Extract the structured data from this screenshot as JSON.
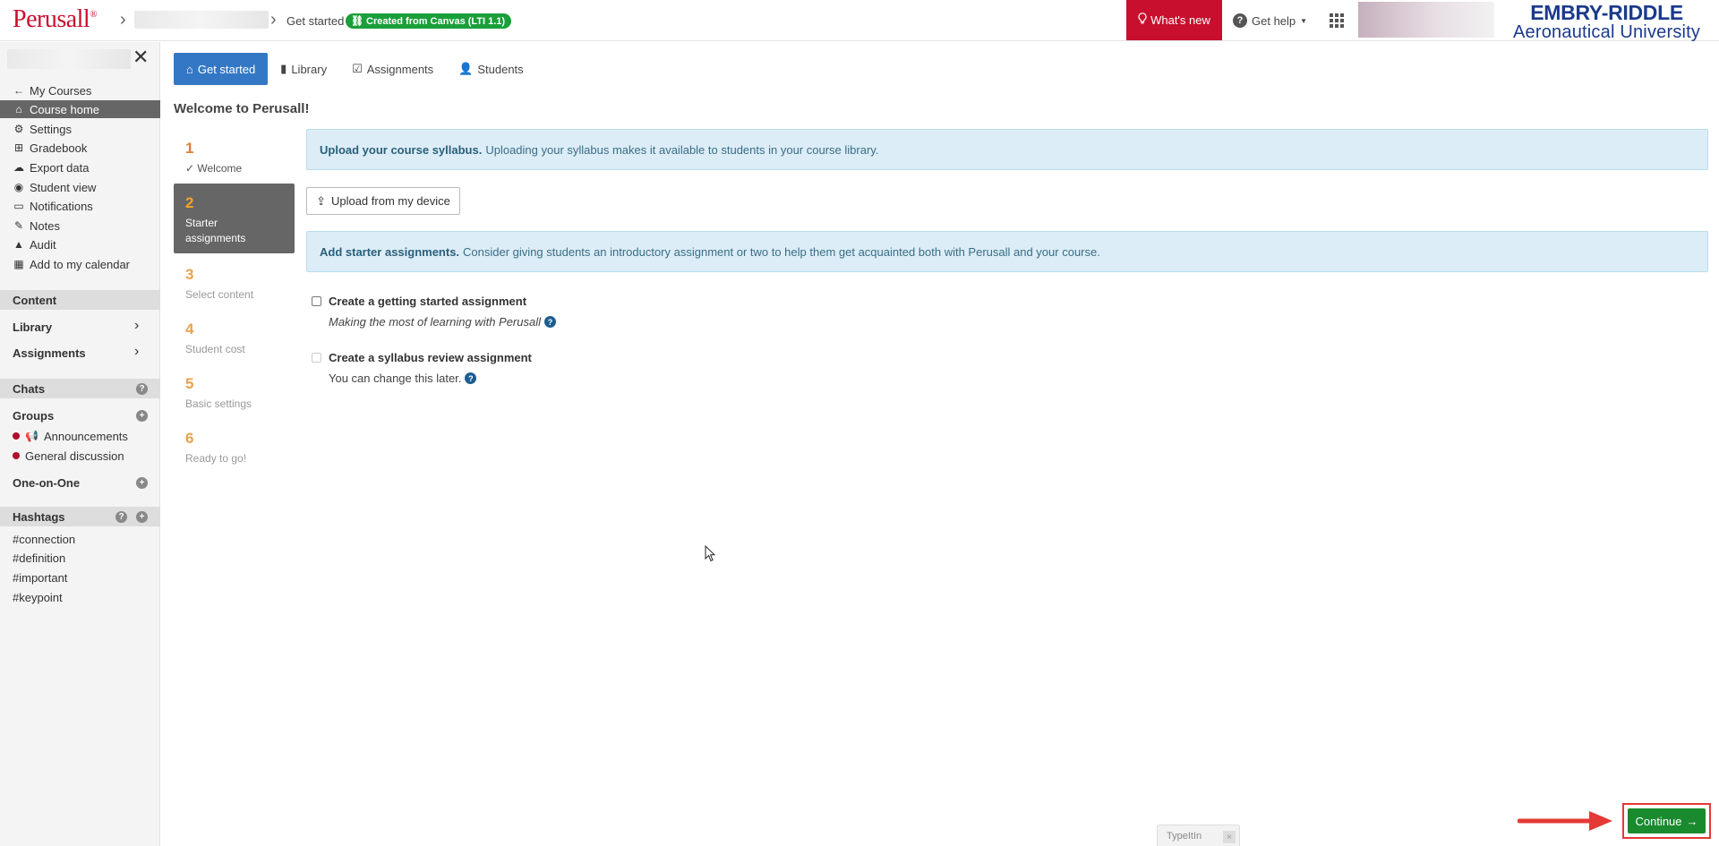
{
  "topbar": {
    "logo": "Perusall",
    "logo_mark": "®",
    "crumb_current": "Get started",
    "lti_badge": "Created from Canvas (LTI 1.1)",
    "whats_new": "What's new",
    "get_help": "Get help",
    "erau_line1": "EMBRY-RIDDLE",
    "erau_line2": "Aeronautical University"
  },
  "sidebar": {
    "nav": [
      {
        "label": "My Courses",
        "icon": "arrow-left-icon"
      },
      {
        "label": "Course home",
        "icon": "home-icon"
      },
      {
        "label": "Settings",
        "icon": "gear-icon"
      },
      {
        "label": "Gradebook",
        "icon": "table-icon"
      },
      {
        "label": "Export data",
        "icon": "cloud-download-icon"
      },
      {
        "label": "Student view",
        "icon": "eye-icon"
      },
      {
        "label": "Notifications",
        "icon": "inbox-icon"
      },
      {
        "label": "Notes",
        "icon": "pencil-icon"
      },
      {
        "label": "Audit",
        "icon": "warning-icon"
      },
      {
        "label": "Add to my calendar",
        "icon": "calendar-icon"
      }
    ],
    "content_section": "Content",
    "library": "Library",
    "assignments": "Assignments",
    "chats_section": "Chats",
    "groups": "Groups",
    "group_items": [
      "Announcements",
      "General discussion"
    ],
    "one_on_one": "One-on-One",
    "hashtags_section": "Hashtags",
    "hashtags": [
      "#connection",
      "#definition",
      "#important",
      "#keypoint"
    ]
  },
  "tabs": [
    {
      "label": "Get started",
      "icon": "home-icon"
    },
    {
      "label": "Library",
      "icon": "book-icon"
    },
    {
      "label": "Assignments",
      "icon": "calendar-check-icon"
    },
    {
      "label": "Students",
      "icon": "user-icon"
    }
  ],
  "page_title": "Welcome to Perusall!",
  "steps": [
    {
      "num": "1",
      "label": "Welcome"
    },
    {
      "num": "2",
      "label_line1": "Starter",
      "label_line2": "assignments"
    },
    {
      "num": "3",
      "label": "Select content"
    },
    {
      "num": "4",
      "label": "Student cost"
    },
    {
      "num": "5",
      "label": "Basic settings"
    },
    {
      "num": "6",
      "label": "Ready to go!"
    }
  ],
  "syllabus_info": {
    "bold": "Upload your course syllabus.",
    "text": "Uploading your syllabus makes it available to students in your course library."
  },
  "upload_button": "Upload from my device",
  "starter_info": {
    "bold": "Add starter assignments.",
    "text": "Consider giving students an introductory assignment or two to help them get acquainted both with Perusall and your course."
  },
  "options": [
    {
      "label": "Create a getting started assignment",
      "sub": "Making the most of learning with Perusall"
    },
    {
      "label": "Create a syllabus review assignment",
      "sub": "You can change this later."
    }
  ],
  "continue_button": "Continue",
  "typeit": "TypeItIn",
  "colors": {
    "accent": "#3478c5",
    "brand": "#c8102e",
    "continue": "#1a8a2e"
  }
}
